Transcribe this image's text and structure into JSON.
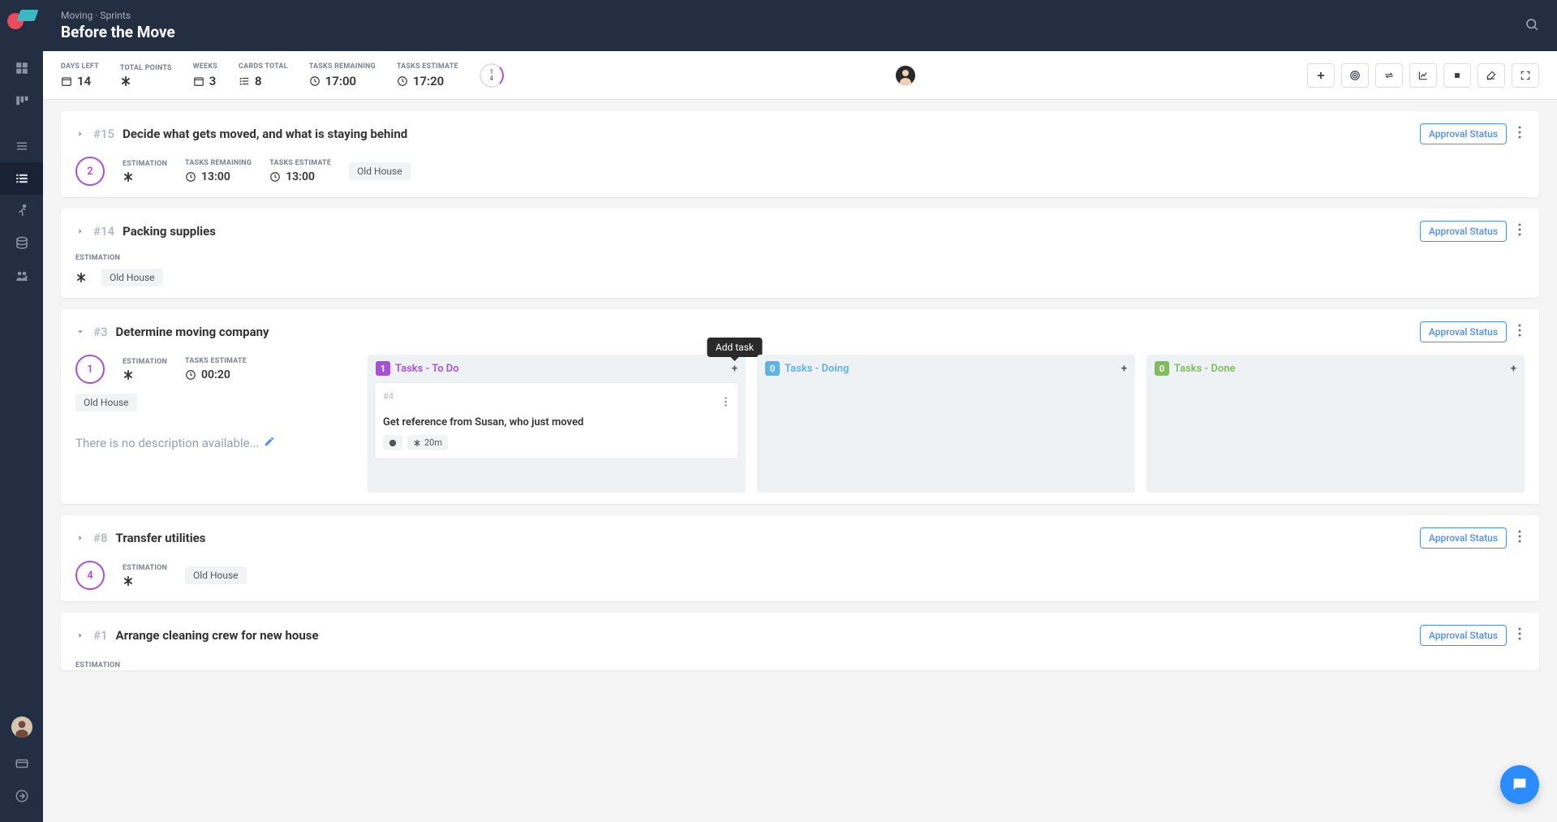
{
  "breadcrumb": "Moving · Sprints",
  "page_title": "Before the Move",
  "metrics": {
    "days_left": {
      "label": "DAYS LEFT",
      "value": "14"
    },
    "total_points": {
      "label": "TOTAL POINTS"
    },
    "weeks": {
      "label": "WEEKS",
      "value": "3"
    },
    "cards_total": {
      "label": "CARDS TOTAL",
      "value": "8"
    },
    "tasks_remaining": {
      "label": "TASKS REMAINING",
      "value": "17:00"
    },
    "tasks_estimate": {
      "label": "TASKS ESTIMATE",
      "value": "17:20"
    },
    "ring_top": "1",
    "ring_bottom": "4"
  },
  "approval_label": "Approval Status",
  "no_description": "There is no description available...",
  "tooltip_add_task": "Add task",
  "cards": [
    {
      "id": "#15",
      "title": "Decide what gets moved, and what is staying behind",
      "circle": "2",
      "est_label": "ESTIMATION",
      "tr_label": "TASKS REMAINING",
      "tr_value": "13:00",
      "te_label": "TASKS ESTIMATE",
      "te_value": "13:00",
      "tag": "Old House"
    },
    {
      "id": "#14",
      "title": "Packing supplies",
      "est_label": "ESTIMATION",
      "tag": "Old House"
    },
    {
      "id": "#3",
      "title": "Determine moving company",
      "circle": "1",
      "est_label": "ESTIMATION",
      "te_label": "TASKS ESTIMATE",
      "te_value": "00:20",
      "tag": "Old House",
      "columns": {
        "todo": {
          "count": "1",
          "label": "Tasks - To Do"
        },
        "doing": {
          "count": "0",
          "label": "Tasks - Doing"
        },
        "done": {
          "count": "0",
          "label": "Tasks - Done"
        }
      },
      "task": {
        "id": "#4",
        "title": "Get reference from Susan, who just moved",
        "time": "20m"
      }
    },
    {
      "id": "#8",
      "title": "Transfer utilities",
      "circle": "4",
      "est_label": "ESTIMATION",
      "tag": "Old House"
    },
    {
      "id": "#1",
      "title": "Arrange cleaning crew for new house",
      "est_label": "ESTIMATION"
    }
  ]
}
